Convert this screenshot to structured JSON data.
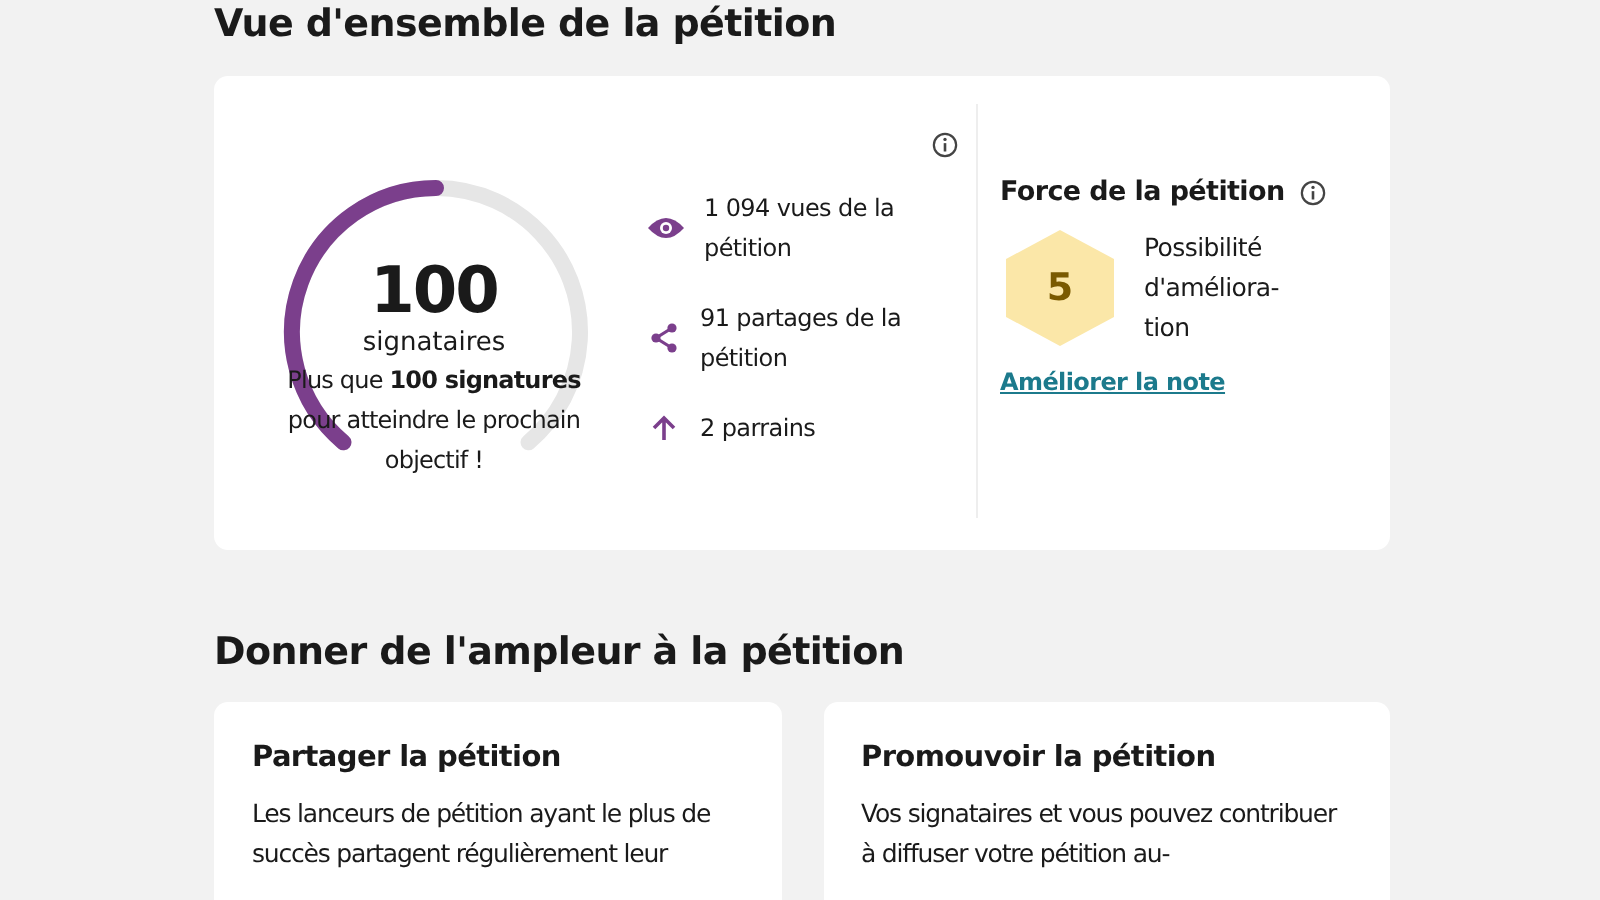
{
  "title": "Vue d'ensemble de la pétition",
  "overview": {
    "signatures": {
      "count": "100",
      "label": "signataires",
      "message": "Plus que **100 signatures** pour atteindre le prochain objectif !"
    },
    "stats": [
      {
        "kind": "views",
        "text": "1 094 vues de la pétition"
      },
      {
        "kind": "shares",
        "text": "91 partages de la pétition"
      },
      {
        "kind": "sponsors",
        "text": "2 parrains"
      }
    ],
    "strength": {
      "title": "Force de la pétition",
      "score": "5",
      "label": "Possibilité d'améliora-tion",
      "link": "Améliorer la note"
    }
  },
  "boost_title": "Donner de l'ampleur à la pétition",
  "cards": [
    {
      "title": "Partager la pétition",
      "text": "Les lanceurs de pétition ayant le plus de succès partagent régulièrement leur"
    },
    {
      "title": "Promouvoir la pétition",
      "text": "Vos signataires et vous pouvez contribuer à diffuser votre pétition au-"
    }
  ]
}
